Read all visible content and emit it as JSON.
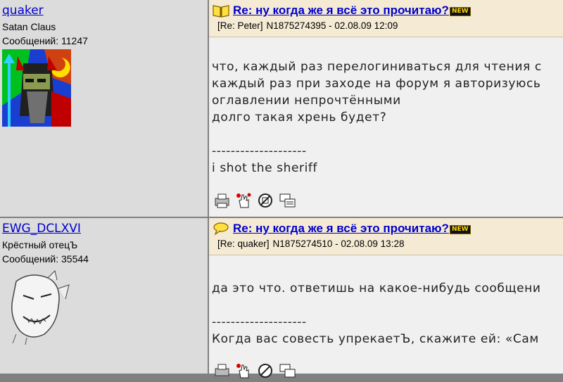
{
  "posts": [
    {
      "author": "quaker",
      "user_title": "Satan Claus",
      "posts_count": "Сообщений: 11247",
      "subject": "Re: ну когда же я всё это прочитаю?",
      "new_badge": "NEW",
      "reply_to": "[Re: Peter]",
      "post_id": "N1875274395 - 02.08.09 12:09",
      "lines": [
        "что, каждый раз перелогиниваться для чтения с",
        "каждый раз при заходе на форум я авторизуюсь",
        "оглавлении непрочтёнными",
        "долго такая хрень будет?",
        "",
        "--------------------",
        "i shot the sheriff"
      ],
      "header_icon": "book-icon"
    },
    {
      "author": "EWG_DCLXVI",
      "user_title": "Крёстный отецЪ",
      "posts_count": "Сообщений: 35544",
      "subject": "Re: ну когда же я всё это прочитаю?",
      "new_badge": "NEW",
      "reply_to": "[Re: quaker]",
      "post_id": "N1875274510 - 02.08.09 13:28",
      "lines": [
        "да это что. ответишь на какое-нибудь сообщени",
        "",
        "--------------------",
        "Когда вас совесть упрекаетЪ, скажите ей: «Сам"
      ],
      "header_icon": "speech-bubble-icon"
    }
  ]
}
